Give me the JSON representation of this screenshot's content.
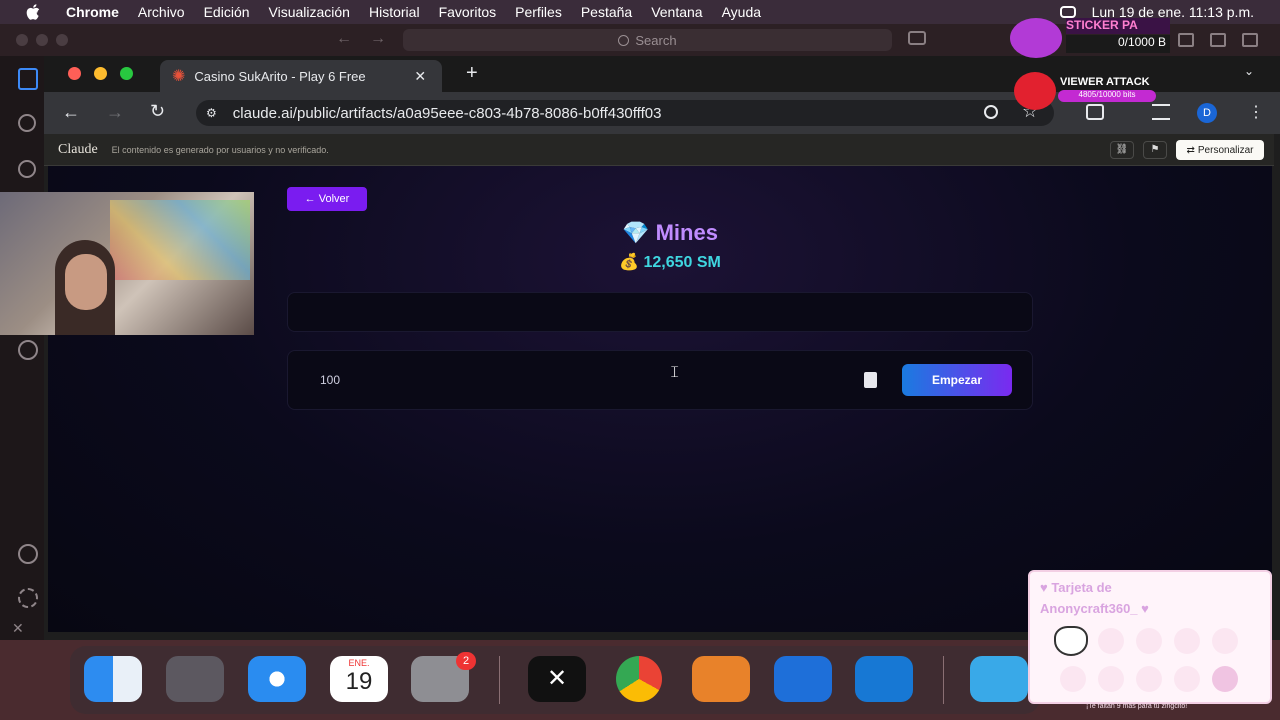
{
  "menubar": {
    "app_name": "Chrome",
    "items": [
      "Archivo",
      "Edición",
      "Visualización",
      "Historial",
      "Favoritos",
      "Perfiles",
      "Pestaña",
      "Ventana",
      "Ayuda"
    ],
    "datetime": "Lun 19 de ene.  11:13 p.m."
  },
  "os_toolbar": {
    "search_placeholder": "Search"
  },
  "browser": {
    "tab_title": "Casino SukArito - Play 6 Free",
    "url": "claude.ai/public/artifacts/a0a95eee-c803-4b78-8086-b0ff430fff03",
    "profile_initial": "D"
  },
  "claude_bar": {
    "logo": "Claude",
    "notice": "El contenido es generado por usuarios y no verificado.",
    "personalize_label": "Personalizar"
  },
  "game": {
    "back_label": "← Volver",
    "title": "Mines",
    "title_icon": "💎",
    "balance": "12,650 SM",
    "balance_icon": "💰",
    "bet_value": "100",
    "start_label": "Empezar"
  },
  "dock": {
    "calendar_month": "ENE.",
    "calendar_day": "19",
    "settings_badge": "2"
  },
  "overlays": {
    "sticker_title": "STICKER PA",
    "sticker_count": "0/1000 B",
    "viewer_title": "VIEWER ATTACK",
    "viewer_count": "4805/10000 bits",
    "card_title_line1": "♥ Tarjeta de",
    "card_title_line2": "Anonycraft360_ ♥",
    "card_footer": "¡Te faltan 9 más para tu zingcito!"
  },
  "colors": {
    "accent_purple": "#7a1cf0",
    "title_purple": "#c08cff",
    "balance_cyan": "#3fd6e0"
  }
}
